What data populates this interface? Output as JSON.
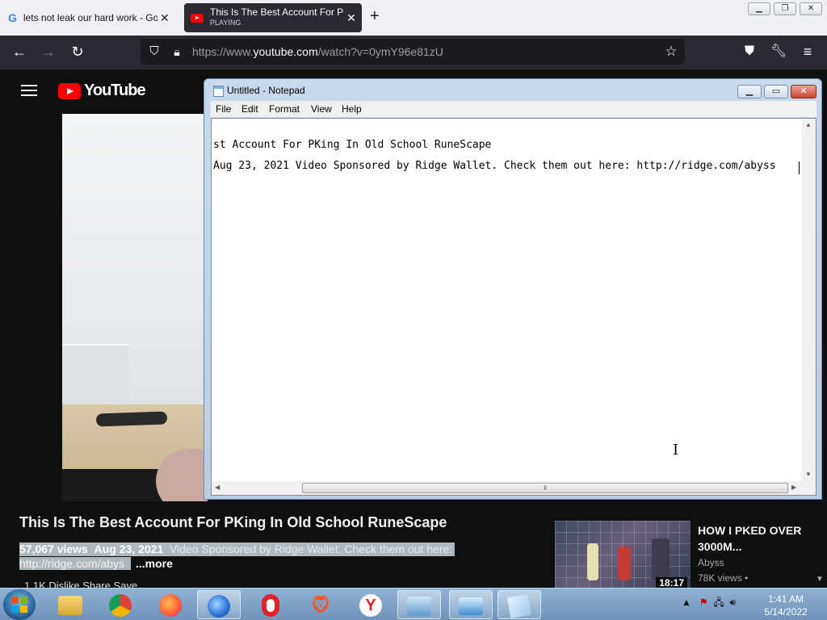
{
  "browser": {
    "tabs": [
      {
        "title": "lets not leak our hard work - Go",
        "favicon": "google-icon"
      },
      {
        "title": "This Is The Best Account For PK",
        "status": "PLAYING",
        "favicon": "youtube-icon"
      }
    ],
    "url_prefix": "https://www.",
    "url_domain": "youtube.com",
    "url_rest": "/watch?v=0ymY96e81zU"
  },
  "youtube": {
    "logo_text": "YouTube",
    "video_title": "This Is The Best Account For PKing In Old School RuneScape",
    "views": "57,067 views",
    "date": "Aug 23, 2021",
    "description": "Video Sponsored by Ridge Wallet. Check them out here:",
    "link": "http://ridge.com/abys",
    "more_label": "...more",
    "actions_partial": "1.1K    Dislike    Share    Save",
    "recommended": {
      "title": "HOW I PKED OVER 3000M...",
      "channel": "Abyss",
      "views": "78K views •",
      "duration": "18:17"
    }
  },
  "notepad": {
    "window_title": "Untitled - Notepad",
    "menu": [
      "File",
      "Edit",
      "Format",
      "View",
      "Help"
    ],
    "lines": [
      "st Account For PKing In Old School RuneScape",
      "Aug 23, 2021  Video Sponsored by Ridge Wallet. Check them out here: http://ridge.com/abyss"
    ]
  },
  "taskbar": {
    "apps": [
      "windows-explorer",
      "chrome",
      "firefox",
      "firefox-dev",
      "opera",
      "brave",
      "yandex",
      "control-panel",
      "remote-desktop",
      "notepad"
    ],
    "time": "1:41 AM",
    "date": "5/14/2022"
  },
  "colors": {
    "youtube_red": "#ff0000",
    "firefox_toolbar": "#2b2a33",
    "taskbar_blue": "#7ea3c8"
  }
}
